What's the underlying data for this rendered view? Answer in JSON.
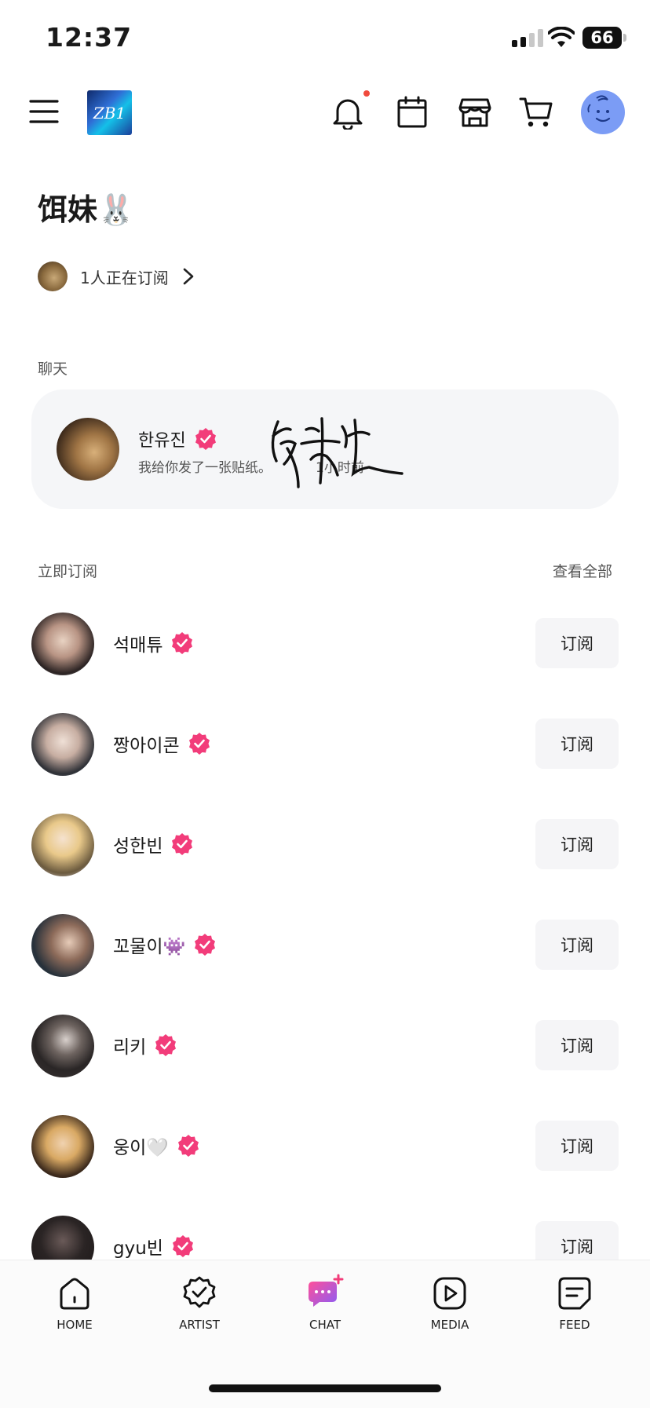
{
  "status_bar": {
    "time": "12:37",
    "battery": "66"
  },
  "header": {
    "logo_text": "ZB1"
  },
  "page": {
    "title": "饵妹🐰",
    "subscribers": "1人正在订阅"
  },
  "chat_section": {
    "label": "聊天",
    "item": {
      "name": "한유진",
      "message": "我给你发了一张贴纸。",
      "time": "1小时前"
    }
  },
  "subscribe_section": {
    "label": "立即订阅",
    "see_all": "查看全部",
    "items": [
      {
        "name": "석매튜",
        "button": "订阅"
      },
      {
        "name": "짱아이콘",
        "button": "订阅"
      },
      {
        "name": "성한빈",
        "button": "订阅"
      },
      {
        "name": "꼬물이👾",
        "button": "订阅"
      },
      {
        "name": "리키",
        "button": "订阅"
      },
      {
        "name": "웅이🤍",
        "button": "订阅"
      },
      {
        "name": "gyu빈",
        "button": "订阅"
      }
    ]
  },
  "tabbar": {
    "home": "HOME",
    "artist": "ARTIST",
    "chat": "CHAT",
    "media": "MEDIA",
    "feed": "FEED"
  },
  "colors": {
    "accent": "#f23c7a",
    "avatar_bg": "#7b9cf5",
    "card_bg": "#f5f6f8"
  }
}
